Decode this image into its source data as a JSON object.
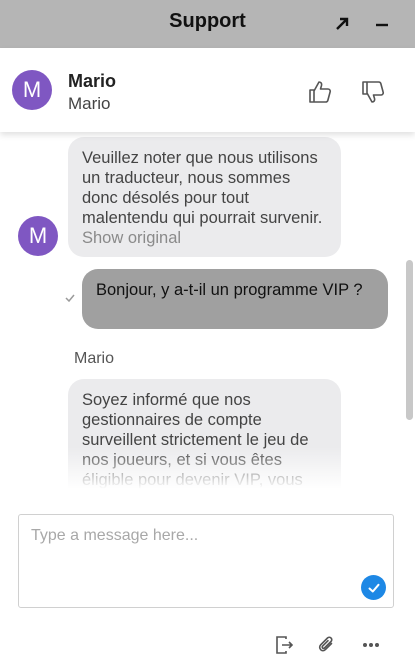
{
  "window": {
    "title": "Support",
    "expand_icon": "arrow-up-right-icon",
    "minimize_icon": "minus-icon"
  },
  "agent": {
    "avatar_letter": "M",
    "name": "Mario",
    "subtitle": "Mario",
    "avatar_color": "#7f57c2"
  },
  "messages": [
    {
      "from": "agent",
      "text": "Veuillez noter que nous utilisons un traducteur, nous sommes donc désolés pour tout malentendu qui pourrait survenir.",
      "link": "Show original"
    },
    {
      "from": "user",
      "text": "Bonjour, y a-t-il un programme VIP ?"
    },
    {
      "from": "agent",
      "sender": "Mario",
      "text": "Soyez informé que nos gestionnaires de compte surveillent strictement le jeu de nos joueurs, et si vous êtes éligible pour devenir VIP, vous"
    }
  ],
  "composer": {
    "placeholder": "Type a message here...",
    "send_color": "#1e88e5"
  },
  "toolbar": {
    "icons": [
      "exit-chat-icon",
      "paperclip-icon",
      "more-icon"
    ]
  }
}
